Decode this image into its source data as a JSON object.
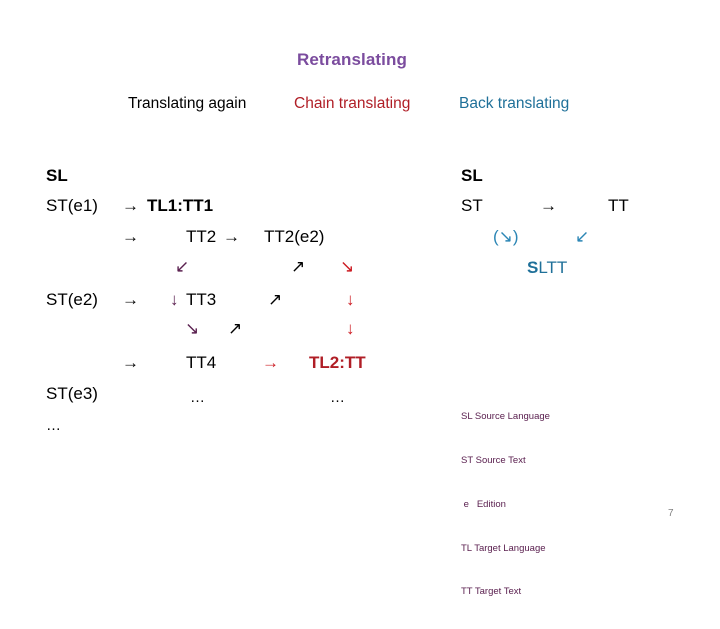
{
  "slide": {
    "title": "Retranslating",
    "page_number": "7",
    "columns": [
      {
        "label": "Translating again",
        "color": "#000000"
      },
      {
        "label": "Chain translating",
        "color": "#B01E26"
      },
      {
        "label": "Back translating",
        "color": "#1F7099"
      }
    ]
  },
  "left_diagram": {
    "sl_label": "SL",
    "st_e1": "ST(e1)",
    "st_e2": "ST(e2)",
    "st_e3": "ST(e3)",
    "ellipsis_under_st": "…",
    "arrow_r1": "→",
    "arrow_r2": "→",
    "arrow_r3": "→",
    "arrow_r4": "→",
    "tl1_tt1": "TL1:TT1",
    "tt2": "TT2",
    "arrow_tt2": "→",
    "tt2_e2": "TT2(e2)",
    "tt3": "TT3",
    "tt4": "TT4",
    "tl2_tt": "TL2:TT",
    "ellipsis_tt": "…",
    "ellipsis_tl": "…",
    "arrow_down_left_1": "↙",
    "arrow_down_1": "↓",
    "arrow_down_right_1": "↘",
    "arrow_up_right_1": "↗",
    "arrow_up_right_2": "↗",
    "arrow_down_right_red": "↘",
    "arrow_down_red_1": "↓",
    "arrow_down_red_2": "↓",
    "arrow_right_red": "→"
  },
  "right_diagram": {
    "sl_label": "SL",
    "st_label": "ST",
    "arrow_right": "→",
    "tt_label": "TT",
    "arrow_paren_down_right": "(↘)",
    "arrow_down_left": "↙",
    "sltt_bold": "S",
    "sltt_rest": "LTT"
  },
  "legend": {
    "items": [
      "SL Source Language",
      "ST Source Text",
      " e   Edition",
      "TL Target Language",
      "TT Target Text"
    ]
  }
}
